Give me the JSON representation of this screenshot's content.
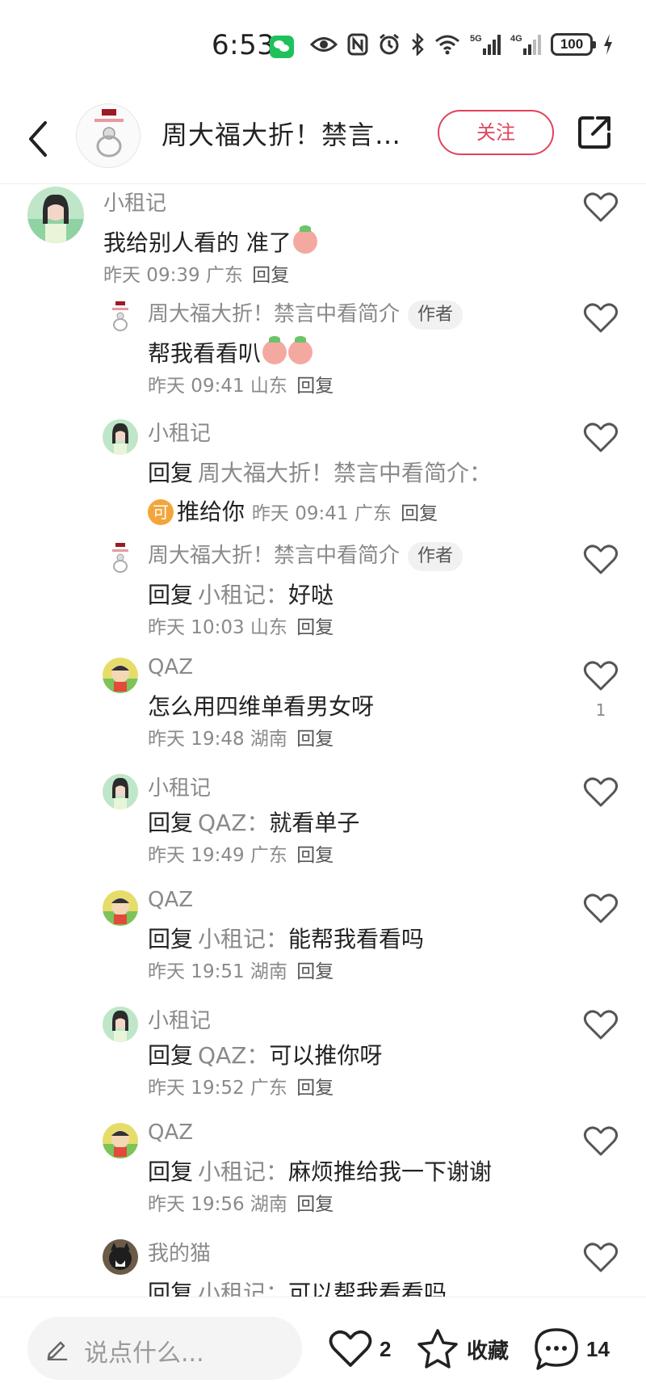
{
  "status_bar": {
    "time": "6:53",
    "battery": "100",
    "signal_1": "5G",
    "signal_2": "4G"
  },
  "header": {
    "title": "周大福大折！禁言…",
    "follow_label": "关注"
  },
  "comments": [
    {
      "name": "小租记",
      "text": "我给别人看的 准了",
      "time": "昨天 09:39",
      "region": "广东",
      "reply": "回复",
      "level": 0,
      "avatar": "girl"
    },
    {
      "name": "周大福大折！禁言中看简介",
      "author_tag": "作者",
      "text": "帮我看看叭",
      "time": "昨天 09:41",
      "region": "山东",
      "reply": "回复",
      "level": 1,
      "avatar": "ring"
    },
    {
      "name": "小租记",
      "reply_prefix": "回复",
      "reply_to": "周大福大折！禁言中看简介：",
      "badge": "可",
      "text": "推给你",
      "time": "昨天 09:41",
      "region": "广东",
      "reply": "回复",
      "level": 1,
      "avatar": "girl"
    },
    {
      "name": "周大福大折！禁言中看简介",
      "author_tag": "作者",
      "reply_prefix": "回复",
      "reply_to": "小租记：",
      "text": "好哒",
      "time": "昨天 10:03",
      "region": "山东",
      "reply": "回复",
      "level": 1,
      "avatar": "ring"
    },
    {
      "name": "QAZ",
      "text": "怎么用四维单看男女呀",
      "time": "昨天 19:48",
      "region": "湖南",
      "reply": "回复",
      "likes": "1",
      "level": 1,
      "avatar": "cartoon"
    },
    {
      "name": "小租记",
      "reply_prefix": "回复",
      "reply_to": "QAZ：",
      "text": "就看单子",
      "time": "昨天 19:49",
      "region": "广东",
      "reply": "回复",
      "level": 1,
      "avatar": "girl"
    },
    {
      "name": "QAZ",
      "reply_prefix": "回复",
      "reply_to": "小租记：",
      "text": "能帮我看看吗",
      "time": "昨天 19:51",
      "region": "湖南",
      "reply": "回复",
      "level": 1,
      "avatar": "cartoon"
    },
    {
      "name": "小租记",
      "reply_prefix": "回复",
      "reply_to": "QAZ：",
      "text": "可以推你呀",
      "time": "昨天 19:52",
      "region": "广东",
      "reply": "回复",
      "level": 1,
      "avatar": "girl"
    },
    {
      "name": "QAZ",
      "reply_prefix": "回复",
      "reply_to": "小租记：",
      "text": "麻烦推给我一下谢谢",
      "time": "昨天 19:56",
      "region": "湖南",
      "reply": "回复",
      "level": 1,
      "avatar": "cartoon"
    },
    {
      "name": "我的猫",
      "reply_prefix": "回复",
      "reply_to": "小租记：",
      "text": "可以帮我看看吗",
      "level": 1,
      "avatar": "cat"
    }
  ],
  "bottom_bar": {
    "input_placeholder": "说点什么...",
    "likes": "2",
    "collect_label": "收藏",
    "comments": "14"
  },
  "colors": {
    "accent": "#e0445b",
    "muted_text": "#8a8a8a"
  }
}
